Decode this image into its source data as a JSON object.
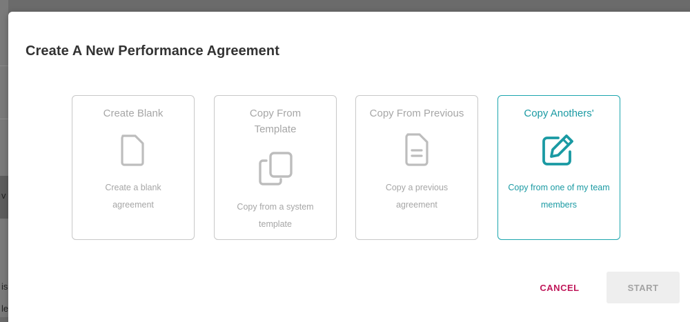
{
  "dialog": {
    "title": "Create A New Performance Agreement"
  },
  "backdrop": {
    "peek_letters": [
      "v",
      "is",
      "le"
    ]
  },
  "options": [
    {
      "title": "Create Blank",
      "description": "Create a blank agreement",
      "icon": "blank-document-icon",
      "selected": false
    },
    {
      "title": "Copy From Template",
      "description": "Copy from a system template",
      "icon": "copy-icon",
      "selected": false
    },
    {
      "title": "Copy From Previous",
      "description": "Copy a previous agreement",
      "icon": "text-document-icon",
      "selected": false
    },
    {
      "title": "Copy Anothers'",
      "description": "Copy from one of my team members",
      "icon": "edit-icon",
      "selected": true
    }
  ],
  "actions": {
    "cancel_label": "CANCEL",
    "start_label": "START",
    "start_enabled": false
  },
  "colors": {
    "accent": "#1a9aa3",
    "cancel": "#c0185a",
    "inactive_text": "#a6a6a6",
    "inactive_icon": "#bdbdbd"
  }
}
